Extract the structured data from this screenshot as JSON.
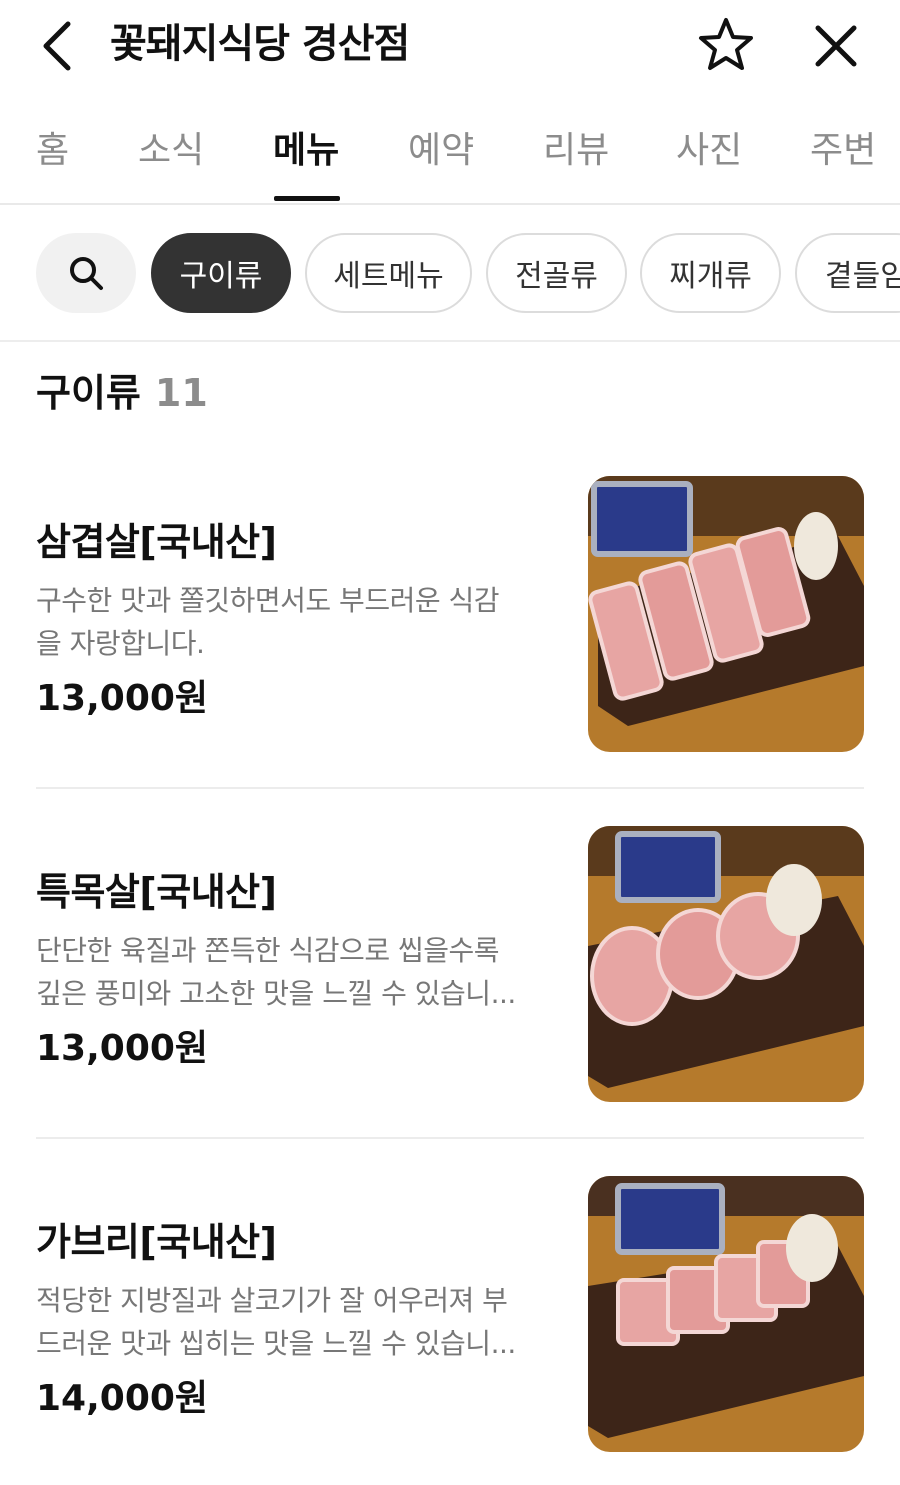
{
  "header": {
    "title": "꽃돼지식당 경산점",
    "back_icon": "chevron-left-icon",
    "favorite_icon": "star-outline-icon",
    "close_icon": "close-icon"
  },
  "tabs": [
    {
      "label": "홈"
    },
    {
      "label": "소식"
    },
    {
      "label": "메뉴",
      "active": true
    },
    {
      "label": "예약"
    },
    {
      "label": "리뷰"
    },
    {
      "label": "사진"
    },
    {
      "label": "주변"
    }
  ],
  "filters": {
    "search_icon": "search-icon",
    "chips": [
      {
        "label": "구이류",
        "selected": true
      },
      {
        "label": "세트메뉴"
      },
      {
        "label": "전골류"
      },
      {
        "label": "찌개류"
      },
      {
        "label": "곁들임"
      }
    ]
  },
  "section": {
    "title": "구이류",
    "count": "11"
  },
  "menu_items": [
    {
      "name": "삼겹살[국내산]",
      "desc_line1": "구수한 맛과 쫄깃하면서도 부드러운 식감",
      "desc_line2": "을 자랑합니다.",
      "price": "13,000원"
    },
    {
      "name": "특목살[국내산]",
      "desc_line1": "단단한 육질과 쫀득한 식감으로 씹을수록",
      "desc_line2": "깊은 풍미와 고소한 맛을 느낄 수 있습니...",
      "price": "13,000원"
    },
    {
      "name": "가브리[국내산]",
      "desc_line1": "적당한 지방질과 살코기가 잘 어우러져 부",
      "desc_line2": "드러운 맛과 씹히는 맛을 느낄 수 있습니...",
      "price": "14,000원"
    }
  ],
  "colors": {
    "selected_chip": "#333333",
    "inactive_tab": "#8c8c8c",
    "wood_board": "#3d2518",
    "table": "#b57a2c",
    "meat": "#e7a5a3"
  }
}
